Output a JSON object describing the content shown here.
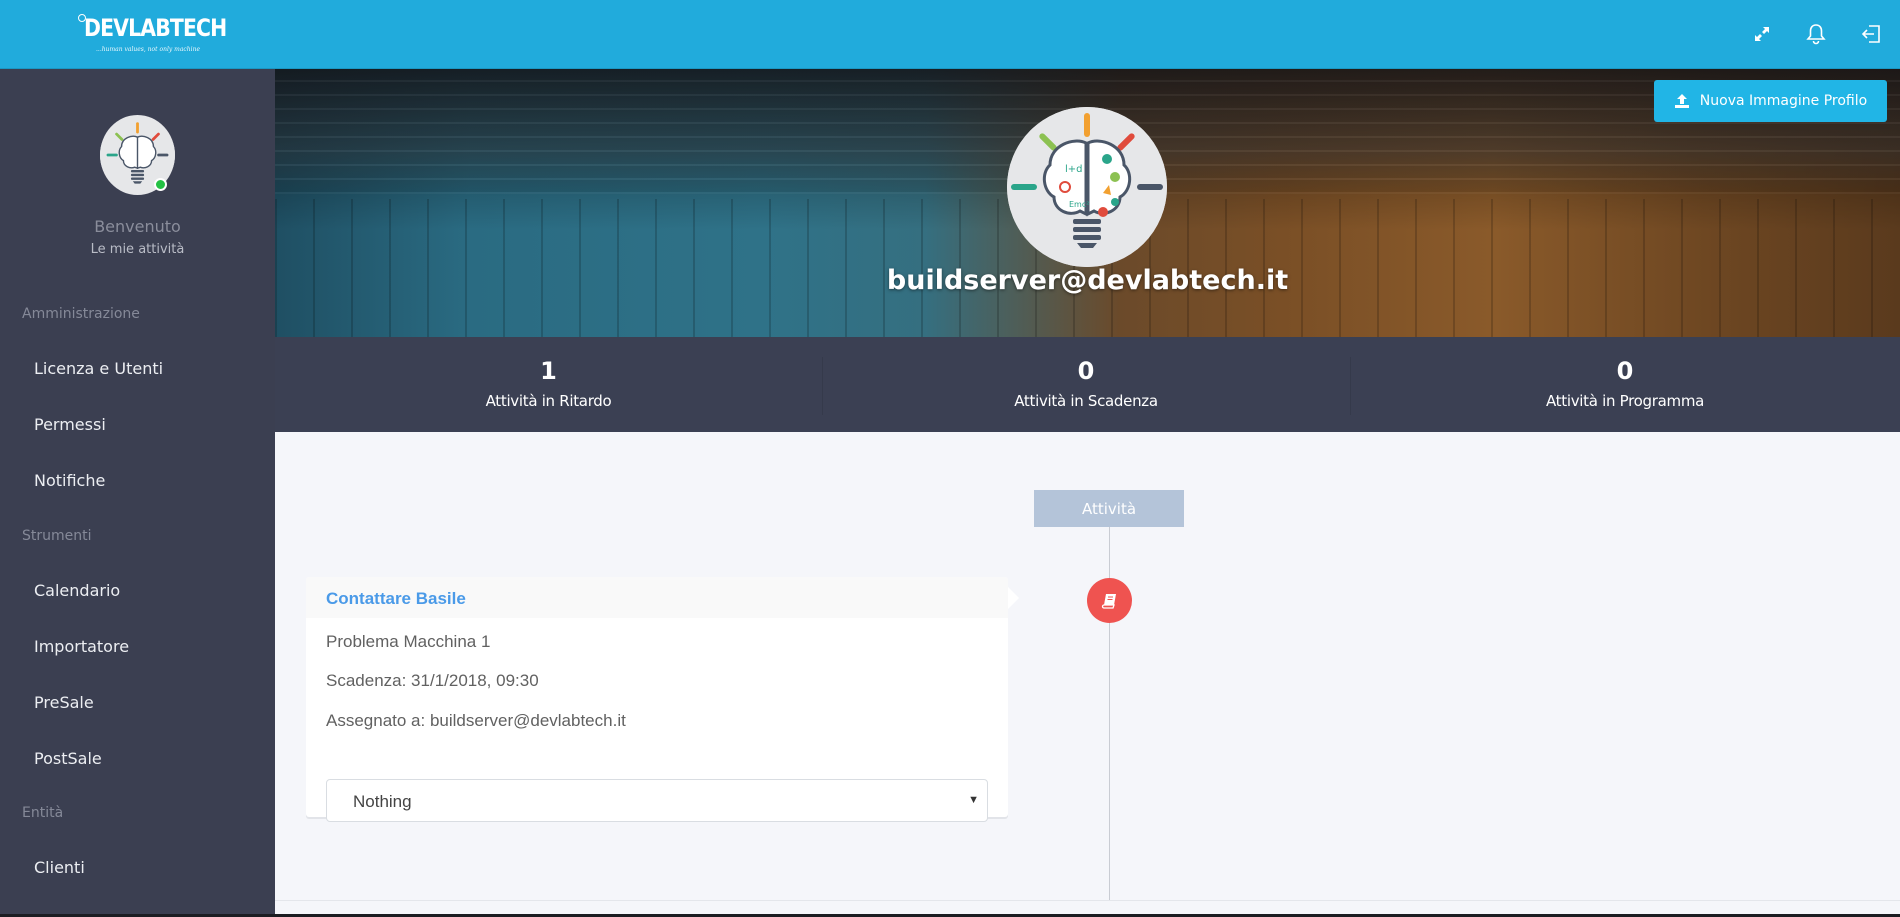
{
  "header": {
    "logo_text": "DEVLABTECH",
    "logo_tagline": "...human values, not only machine",
    "icons": [
      "fullscreen-icon",
      "bell-icon",
      "logout-icon"
    ]
  },
  "sidebar": {
    "welcome": "Benvenuto",
    "subtitle": "Le mie attività",
    "status_color": "#24c144",
    "sections": [
      {
        "title": "Amministrazione",
        "items": [
          "Licenza e Utenti",
          "Permessi",
          "Notifiche"
        ]
      },
      {
        "title": "Strumenti",
        "items": [
          "Calendario",
          "Importatore",
          "PreSale",
          "PostSale"
        ]
      },
      {
        "title": "Entità",
        "items": [
          "Clienti"
        ]
      }
    ]
  },
  "profile": {
    "email": "buildserver@devlabtech.it",
    "new_image_button": "Nuova Immagine Profilo"
  },
  "stats": [
    {
      "value": "1",
      "label": "Attività in Ritardo"
    },
    {
      "value": "0",
      "label": "Attività in Scadenza"
    },
    {
      "value": "0",
      "label": "Attività in Programma"
    }
  ],
  "timeline": {
    "header": "Attività",
    "accent_color": "#ef5350",
    "items": [
      {
        "title": "Contattare Basile",
        "description": "Problema Macchina 1",
        "due": "Scadenza: 31/1/2018, 09:30",
        "assigned": "Assegnato a: buildserver@devlabtech.it",
        "select_value": "Nothing",
        "icon": "book-icon"
      }
    ]
  },
  "colors": {
    "topbar": "#21abdc",
    "sidebar": "#3b3f51",
    "button": "#21b5e6",
    "link": "#4a9ae8"
  }
}
